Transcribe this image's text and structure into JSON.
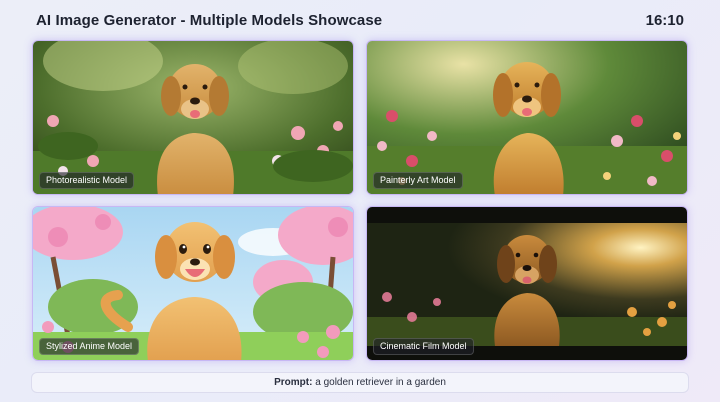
{
  "header": {
    "title": "AI Image Generator - Multiple Models Showcase",
    "time": "16:10"
  },
  "cards": [
    {
      "label": "Photorealistic Model"
    },
    {
      "label": "Painterly Art Model"
    },
    {
      "label": "Stylized Anime Model"
    },
    {
      "label": "Cinematic Film Model"
    }
  ],
  "prompt": {
    "label": "Prompt:",
    "text": "a golden retriever in a garden"
  }
}
